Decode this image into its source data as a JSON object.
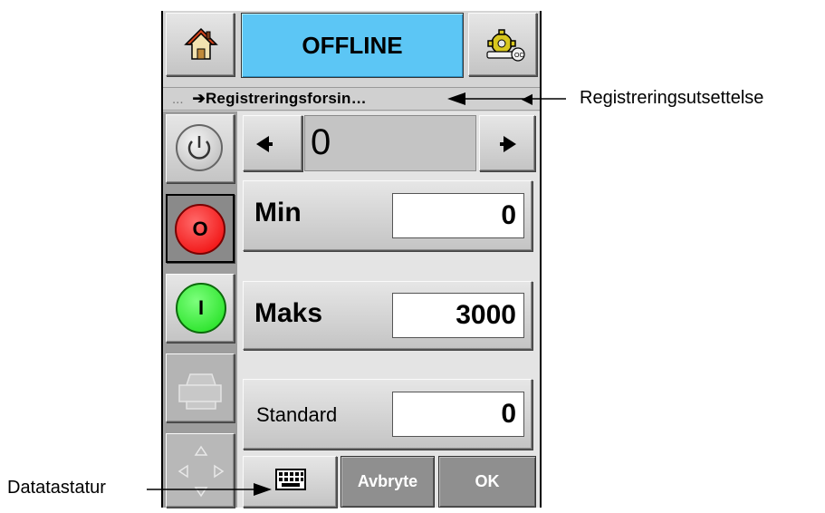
{
  "header": {
    "status_label": "OFFLINE",
    "home_icon": "home-icon",
    "settings_icon": "gear-key-icon"
  },
  "titlebar": {
    "dots": "...",
    "title": "➔Registreringsforsin…"
  },
  "sidebar": {
    "items": [
      {
        "name": "power-button",
        "icon": "power-icon"
      },
      {
        "name": "stop-button",
        "icon": "red-circle-icon",
        "label": "O"
      },
      {
        "name": "start-button",
        "icon": "green-circle-icon",
        "label": "I"
      },
      {
        "name": "print-button",
        "icon": "printer-icon"
      },
      {
        "name": "navigation-button",
        "icon": "arrows-icon"
      }
    ]
  },
  "stepper": {
    "value": "0"
  },
  "fields": {
    "min_label": "Min",
    "min_value": "0",
    "max_label": "Maks",
    "max_value": "3000",
    "default_label": "Standard",
    "default_value": "0"
  },
  "footer": {
    "keyboard_icon": "keyboard-icon",
    "cancel_label": "Avbryte",
    "ok_label": "OK"
  },
  "callouts": {
    "right": "Registreringsutsettelse",
    "left": "Datatastatur"
  },
  "colors": {
    "offline": "#5cc6f5",
    "stop": "#ff1a1a",
    "start": "#22ee22"
  }
}
